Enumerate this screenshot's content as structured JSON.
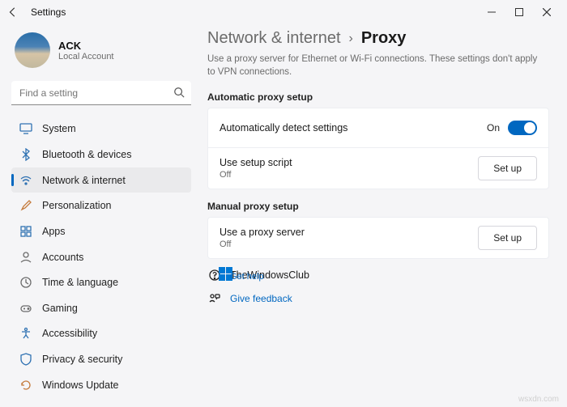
{
  "titlebar": {
    "title": "Settings"
  },
  "profile": {
    "name": "ACK",
    "subtitle": "Local Account"
  },
  "search": {
    "placeholder": "Find a setting"
  },
  "nav": {
    "items": [
      {
        "label": "System"
      },
      {
        "label": "Bluetooth & devices"
      },
      {
        "label": "Network & internet"
      },
      {
        "label": "Personalization"
      },
      {
        "label": "Apps"
      },
      {
        "label": "Accounts"
      },
      {
        "label": "Time & language"
      },
      {
        "label": "Gaming"
      },
      {
        "label": "Accessibility"
      },
      {
        "label": "Privacy & security"
      },
      {
        "label": "Windows Update"
      }
    ]
  },
  "breadcrumb": {
    "parent": "Network & internet",
    "current": "Proxy"
  },
  "subtitle": "Use a proxy server for Ethernet or Wi-Fi connections. These settings don't apply to VPN connections.",
  "sections": {
    "auto": {
      "title": "Automatic proxy setup",
      "row1": {
        "label": "Automatically detect settings",
        "state": "On"
      },
      "row2": {
        "label": "Use setup script",
        "sub": "Off",
        "button": "Set up"
      }
    },
    "manual": {
      "title": "Manual proxy setup",
      "row1": {
        "label": "Use a proxy server",
        "sub": "Off",
        "button": "Set up"
      }
    }
  },
  "overlay": {
    "brand": "TheWindowsClub"
  },
  "links": {
    "help": "Get help",
    "feedback": "Give feedback"
  },
  "watermark": "wsxdn.com"
}
